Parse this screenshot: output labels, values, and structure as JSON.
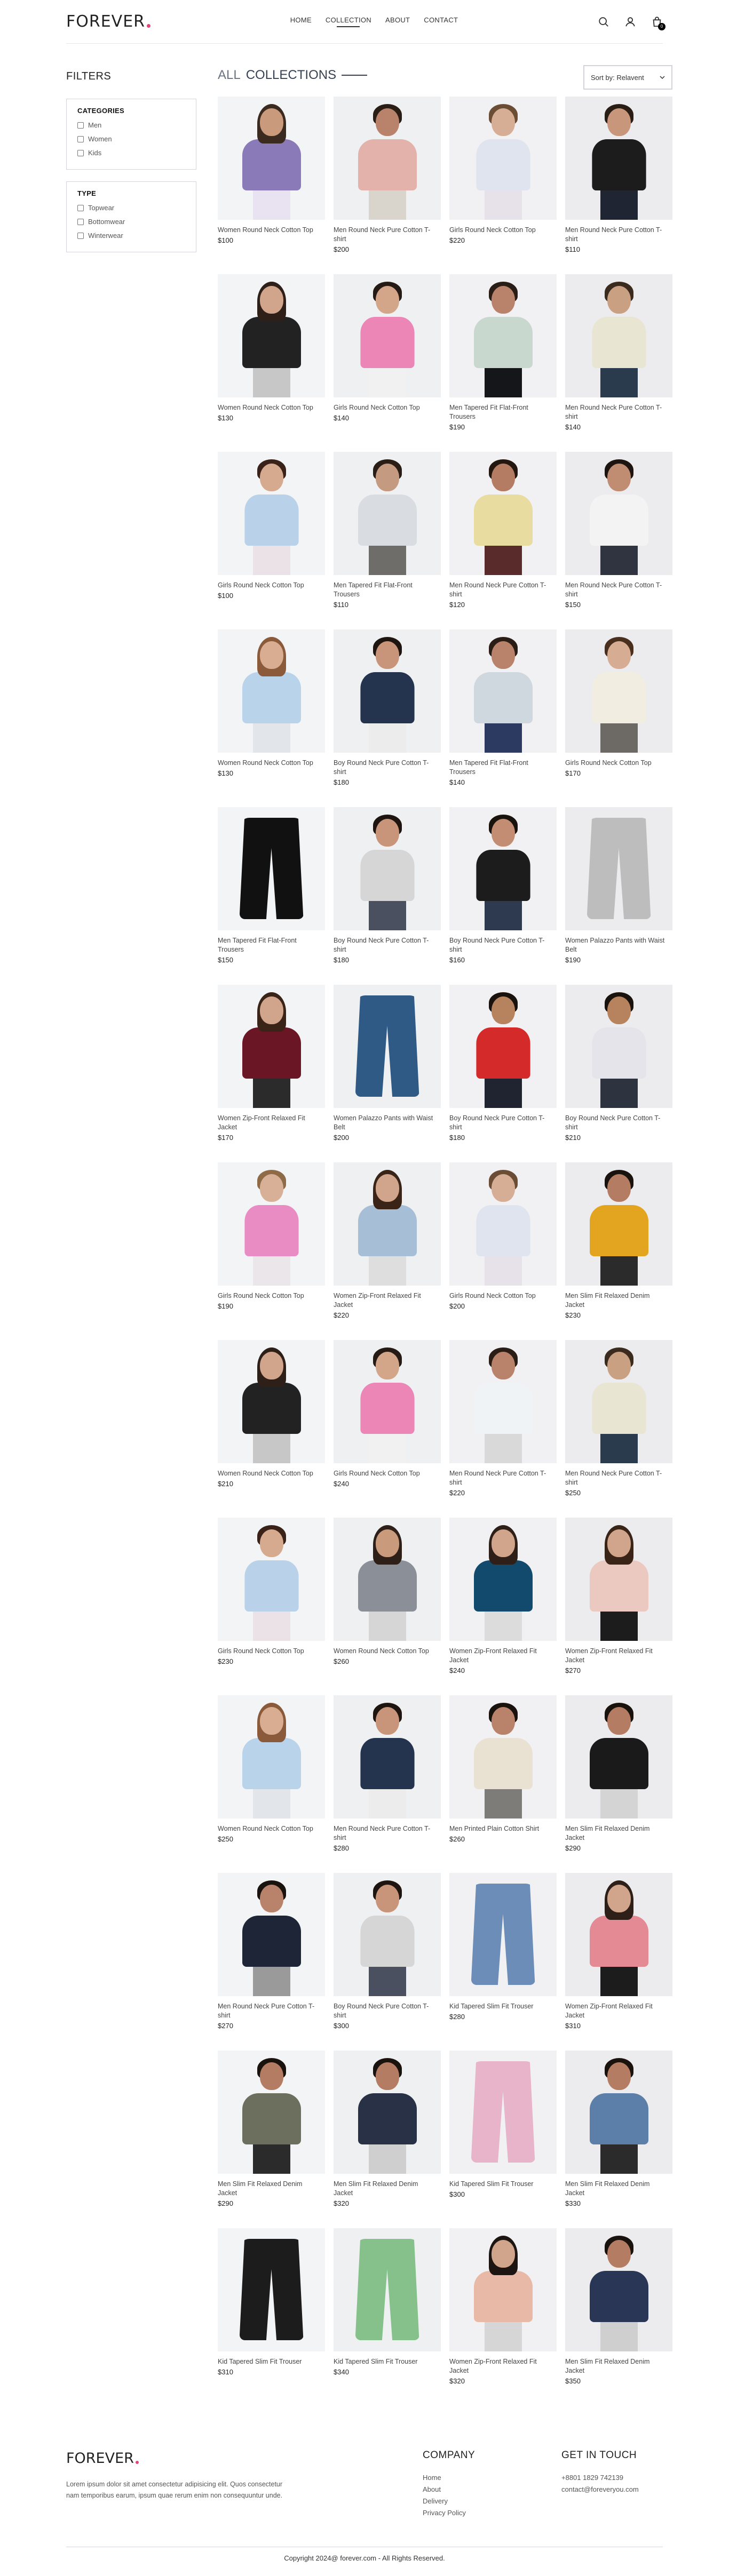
{
  "brand": {
    "name": "FOREVER",
    "accent_color": "#e0457b"
  },
  "nav": {
    "links": [
      "HOME",
      "COLLECTION",
      "ABOUT",
      "CONTACT"
    ],
    "active": "COLLECTION",
    "icons": [
      "search-icon",
      "user-icon",
      "cart-icon"
    ],
    "cart_count": "0"
  },
  "filters": {
    "title": "FILTERS",
    "categories": {
      "title": "CATEGORIES",
      "options": [
        "Men",
        "Women",
        "Kids"
      ]
    },
    "type": {
      "title": "TYPE",
      "options": [
        "Topwear",
        "Bottomwear",
        "Winterwear"
      ]
    }
  },
  "collection": {
    "title_1": "ALL",
    "title_2": "COLLECTIONS",
    "sort_label": "Sort by: Relavent"
  },
  "products": [
    {
      "name": "Women Round Neck Cotton Top",
      "price": "$100",
      "kind": "woman",
      "top": "#8a7ab8",
      "bottom": "#e9e3f1",
      "skin": "#c99a7c",
      "hair": "#3b2a20"
    },
    {
      "name": "Men Round Neck Pure Cotton T-shirt",
      "price": "$200",
      "kind": "man",
      "top": "#e3b2aa",
      "bottom": "#d9d4cc",
      "skin": "#b9826a",
      "hair": "#2a1d16"
    },
    {
      "name": "Girls Round Neck Cotton Top",
      "price": "$220",
      "kind": "kid",
      "top": "#dfe4ee",
      "bottom": "#e7e2ea",
      "skin": "#d6ae95",
      "hair": "#6b4d35"
    },
    {
      "name": "Men Round Neck Pure Cotton T-shirt",
      "price": "$110",
      "kind": "kid",
      "top": "#1c1c1c",
      "bottom": "#1f2532",
      "skin": "#c8967a",
      "hair": "#2a1d16"
    },
    {
      "name": "Women Round Neck Cotton Top",
      "price": "$130",
      "kind": "woman",
      "top": "#222222",
      "bottom": "#c7c7c7",
      "skin": "#d1a58c",
      "hair": "#2e2018"
    },
    {
      "name": "Girls Round Neck Cotton Top",
      "price": "$140",
      "kind": "kid",
      "top": "#ec86b7",
      "bottom": "#f1f1f1",
      "skin": "#d3a68a",
      "hair": "#261a14"
    },
    {
      "name": "Men Tapered Fit Flat-Front Trousers",
      "price": "$190",
      "kind": "man",
      "top": "#c9d8cf",
      "bottom": "#15161a",
      "skin": "#b9826a",
      "hair": "#2a1d16"
    },
    {
      "name": "Men Round Neck Pure Cotton T-shirt",
      "price": "$140",
      "kind": "kid",
      "top": "#e9e5d3",
      "bottom": "#2b3b4e",
      "skin": "#caa083",
      "hair": "#3b2a1e"
    },
    {
      "name": "Girls Round Neck Cotton Top",
      "price": "$100",
      "kind": "kid",
      "top": "#b9d2ea",
      "bottom": "#ebe2e8",
      "skin": "#d5aa8e",
      "hair": "#3b2218"
    },
    {
      "name": "Men Tapered Fit Flat-Front Trousers",
      "price": "$110",
      "kind": "man",
      "top": "#d9dde2",
      "bottom": "#6f6d69",
      "skin": "#c49a80",
      "hair": "#2a1d16"
    },
    {
      "name": "Men Round Neck Pure Cotton T-shirt",
      "price": "$120",
      "kind": "man",
      "top": "#e8dca0",
      "bottom": "#5a2b2b",
      "skin": "#b47c63",
      "hair": "#24170f"
    },
    {
      "name": "Men Round Neck Pure Cotton T-shirt",
      "price": "$150",
      "kind": "man",
      "top": "#f3f3f3",
      "bottom": "#2f3440",
      "skin": "#c08c72",
      "hair": "#1f1510"
    },
    {
      "name": "Women Round Neck Cotton Top",
      "price": "$130",
      "kind": "woman",
      "top": "#b8d3ea",
      "bottom": "#e2e6ea",
      "skin": "#d9ad91",
      "hair": "#8a5a3a"
    },
    {
      "name": "Boy Round Neck Pure Cotton T-shirt",
      "price": "$180",
      "kind": "kid",
      "top": "#24344f",
      "bottom": "#ececec",
      "skin": "#c9957a",
      "hair": "#1f1510"
    },
    {
      "name": "Men Tapered Fit Flat-Front Trousers",
      "price": "$140",
      "kind": "man",
      "top": "#cfd8de",
      "bottom": "#2c3a62",
      "skin": "#b9826a",
      "hair": "#2a1d16"
    },
    {
      "name": "Girls Round Neck Cotton Top",
      "price": "$170",
      "kind": "kid",
      "top": "#f1ede0",
      "bottom": "#6d6a65",
      "skin": "#d6ad92",
      "hair": "#4a2e1e"
    },
    {
      "name": "Men Tapered Fit Flat-Front Trousers",
      "price": "$150",
      "kind": "pants",
      "top": "#111111",
      "bottom": "#111111",
      "skin": "#b9826a",
      "hair": "#2a1d16"
    },
    {
      "name": "Boy Round Neck Pure Cotton T-shirt",
      "price": "$180",
      "kind": "kid",
      "top": "#d6d6d6",
      "bottom": "#4a5060",
      "skin": "#c9957a",
      "hair": "#1f1510"
    },
    {
      "name": "Boy Round Neck Pure Cotton T-shirt",
      "price": "$160",
      "kind": "kid",
      "top": "#1c1c1c",
      "bottom": "#2d3a50",
      "skin": "#c28d72",
      "hair": "#1a120c"
    },
    {
      "name": "Women Palazzo Pants with Waist Belt",
      "price": "$190",
      "kind": "pants",
      "top": "#bdbdbd",
      "bottom": "#9a9a9a",
      "skin": "#d1a58c",
      "hair": "#2e2018"
    },
    {
      "name": "Women Zip-Front Relaxed Fit Jacket",
      "price": "$170",
      "kind": "woman",
      "top": "#6b1625",
      "bottom": "#2b2b2b",
      "skin": "#d1a58c",
      "hair": "#3a2418"
    },
    {
      "name": "Women Palazzo Pants with Waist Belt",
      "price": "$200",
      "kind": "pants",
      "top": "#2f5a86",
      "bottom": "#2f5a86",
      "skin": "#d1a58c",
      "hair": "#2e2018"
    },
    {
      "name": "Boy Round Neck Pure Cotton T-shirt",
      "price": "$180",
      "kind": "kid",
      "top": "#d52a2a",
      "bottom": "#1f2430",
      "skin": "#b7835f",
      "hair": "#1a120c"
    },
    {
      "name": "Boy Round Neck Pure Cotton T-shirt",
      "price": "$210",
      "kind": "kid",
      "top": "#e4e4ea",
      "bottom": "#2d3440",
      "skin": "#b7835f",
      "hair": "#1a120c"
    },
    {
      "name": "Girls Round Neck Cotton Top",
      "price": "$190",
      "kind": "kid",
      "top": "#ea8cc4",
      "bottom": "#ebe6ea",
      "skin": "#d8b097",
      "hair": "#8e6a46"
    },
    {
      "name": "Women Zip-Front Relaxed Fit Jacket",
      "price": "$220",
      "kind": "woman",
      "top": "#a7bfd6",
      "bottom": "#dedede",
      "skin": "#d1a58c",
      "hair": "#3a2418"
    },
    {
      "name": "Girls Round Neck Cotton Top",
      "price": "$200",
      "kind": "kid",
      "top": "#dfe4ee",
      "bottom": "#e7e2ea",
      "skin": "#d6ae95",
      "hair": "#6b4d35"
    },
    {
      "name": "Men Slim Fit Relaxed Denim Jacket",
      "price": "$230",
      "kind": "man",
      "top": "#e3a520",
      "bottom": "#2b2b2b",
      "skin": "#b47c63",
      "hair": "#1a120c"
    },
    {
      "name": "Women Round Neck Cotton Top",
      "price": "$210",
      "kind": "woman",
      "top": "#222222",
      "bottom": "#c7c7c7",
      "skin": "#d1a58c",
      "hair": "#2e2018"
    },
    {
      "name": "Girls Round Neck Cotton Top",
      "price": "$240",
      "kind": "kid",
      "top": "#ec86b7",
      "bottom": "#f1f1f1",
      "skin": "#d3a68a",
      "hair": "#261a14"
    },
    {
      "name": "Men Round Neck Pure Cotton T-shirt",
      "price": "$220",
      "kind": "man",
      "top": "#f0f3f5",
      "bottom": "#d9d9d9",
      "skin": "#b9826a",
      "hair": "#2a1d16"
    },
    {
      "name": "Men Round Neck Pure Cotton T-shirt",
      "price": "$250",
      "kind": "kid",
      "top": "#e9e5d3",
      "bottom": "#2b3b4e",
      "skin": "#caa083",
      "hair": "#3b2a1e"
    },
    {
      "name": "Girls Round Neck Cotton Top",
      "price": "$230",
      "kind": "kid",
      "top": "#b9d2ea",
      "bottom": "#ebe2e8",
      "skin": "#d5aa8e",
      "hair": "#3b2218"
    },
    {
      "name": "Women Round Neck Cotton Top",
      "price": "$260",
      "kind": "woman",
      "top": "#8b8f98",
      "bottom": "#d6d6d6",
      "skin": "#c99a7c",
      "hair": "#2e2018"
    },
    {
      "name": "Women Zip-Front Relaxed Fit Jacket",
      "price": "$240",
      "kind": "woman",
      "top": "#114a6c",
      "bottom": "#dcdcdc",
      "skin": "#d1a58c",
      "hair": "#2e2018"
    },
    {
      "name": "Women Zip-Front Relaxed Fit Jacket",
      "price": "$270",
      "kind": "woman",
      "top": "#ebc8c0",
      "bottom": "#1c1c1c",
      "skin": "#d1a58c",
      "hair": "#3a2418"
    },
    {
      "name": "Women Round Neck Cotton Top",
      "price": "$250",
      "kind": "woman",
      "top": "#b8d3ea",
      "bottom": "#e2e6ea",
      "skin": "#d9ad91",
      "hair": "#8a5a3a"
    },
    {
      "name": "Men Round Neck Pure Cotton T-shirt",
      "price": "$280",
      "kind": "kid",
      "top": "#24344f",
      "bottom": "#ececec",
      "skin": "#c9957a",
      "hair": "#1f1510"
    },
    {
      "name": "Men Printed Plain Cotton Shirt",
      "price": "$260",
      "kind": "man",
      "top": "#e9e1d2",
      "bottom": "#7d7c78",
      "skin": "#b9826a",
      "hair": "#1a120c"
    },
    {
      "name": "Men Slim Fit Relaxed Denim Jacket",
      "price": "$290",
      "kind": "man",
      "top": "#1a1a1a",
      "bottom": "#d4d4d4",
      "skin": "#b47c63",
      "hair": "#1a120c"
    },
    {
      "name": "Men Round Neck Pure Cotton T-shirt",
      "price": "$270",
      "kind": "man",
      "top": "#1e2536",
      "bottom": "#9a9a9a",
      "skin": "#b9826a",
      "hair": "#1a120c"
    },
    {
      "name": "Boy Round Neck Pure Cotton T-shirt",
      "price": "$300",
      "kind": "kid",
      "top": "#d6d6d6",
      "bottom": "#4a5060",
      "skin": "#c9957a",
      "hair": "#1f1510"
    },
    {
      "name": "Kid Tapered Slim Fit Trouser",
      "price": "$280",
      "kind": "pants",
      "top": "#6b8db8",
      "bottom": "#6b8db8",
      "skin": "#d1a58c",
      "hair": "#2e2018"
    },
    {
      "name": "Women Zip-Front Relaxed Fit Jacket",
      "price": "$310",
      "kind": "woman",
      "top": "#e38a94",
      "bottom": "#1c1c1c",
      "skin": "#d1a58c",
      "hair": "#2e2018"
    },
    {
      "name": "Men Slim Fit Relaxed Denim Jacket",
      "price": "$290",
      "kind": "man",
      "top": "#6d6f5e",
      "bottom": "#2b2b2b",
      "skin": "#b47c63",
      "hair": "#1a120c"
    },
    {
      "name": "Men Slim Fit Relaxed Denim Jacket",
      "price": "$320",
      "kind": "man",
      "top": "#283146",
      "bottom": "#cfcfcf",
      "skin": "#b47c63",
      "hair": "#1a120c"
    },
    {
      "name": "Kid Tapered Slim Fit Trouser",
      "price": "$300",
      "kind": "pants",
      "top": "#e7b4c9",
      "bottom": "#e7b4c9",
      "skin": "#d1a58c",
      "hair": "#2e2018"
    },
    {
      "name": "Men Slim Fit Relaxed Denim Jacket",
      "price": "$330",
      "kind": "man",
      "top": "#5b7fa8",
      "bottom": "#2b2b2b",
      "skin": "#b47c63",
      "hair": "#1a120c"
    },
    {
      "name": "Kid Tapered Slim Fit Trouser",
      "price": "$310",
      "kind": "pants",
      "top": "#1c1c1c",
      "bottom": "#1c1c1c",
      "skin": "#d1a58c",
      "hair": "#2e2018"
    },
    {
      "name": "Kid Tapered Slim Fit Trouser",
      "price": "$340",
      "kind": "pants",
      "top": "#86c08a",
      "bottom": "#86c08a",
      "skin": "#d1a58c",
      "hair": "#2e2018"
    },
    {
      "name": "Women Zip-Front Relaxed Fit Jacket",
      "price": "$320",
      "kind": "woman",
      "top": "#e7b9a6",
      "bottom": "#d6d6d6",
      "skin": "#d1a58c",
      "hair": "#1c1512"
    },
    {
      "name": "Men Slim Fit Relaxed Denim Jacket",
      "price": "$350",
      "kind": "man",
      "top": "#2a3656",
      "bottom": "#cfcfcf",
      "skin": "#b47c63",
      "hair": "#1a120c"
    }
  ],
  "footer": {
    "logo": "FOREVER",
    "description": "Lorem ipsum dolor sit amet consectetur adipisicing elit. Quos consectetur nam temporibus earum, ipsum quae rerum enim non consequuntur unde.",
    "company": {
      "title": "COMPANY",
      "links": [
        "Home",
        "About",
        "Delivery",
        "Privacy Policy"
      ]
    },
    "contact": {
      "title": "GET IN TOUCH",
      "phone": "+8801 1829 742139",
      "email": "contact@foreveryou.com"
    },
    "copyright": "Copyright 2024@ forever.com - All Rights Reserved."
  }
}
